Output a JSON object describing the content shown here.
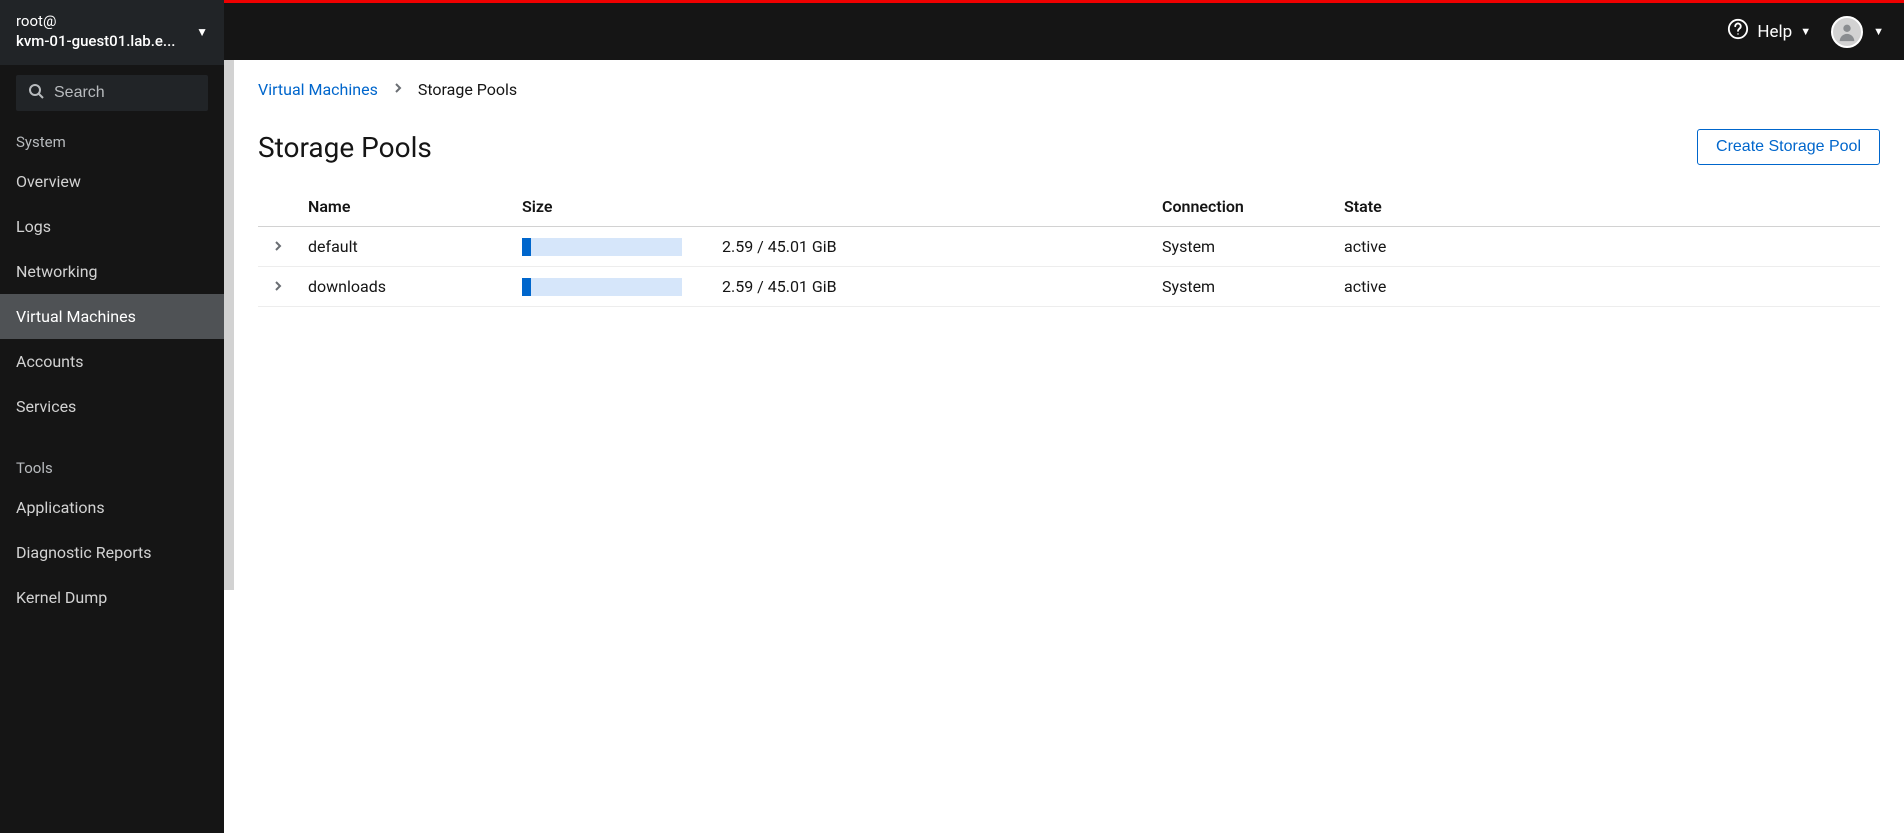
{
  "host_switcher": {
    "user_line": "root@",
    "host_line": "kvm-01-guest01.lab.e..."
  },
  "search": {
    "placeholder": "Search"
  },
  "sidebar": {
    "system_label": "System",
    "system_items": [
      {
        "label": "Overview",
        "active": false
      },
      {
        "label": "Logs",
        "active": false
      },
      {
        "label": "Networking",
        "active": false
      },
      {
        "label": "Virtual Machines",
        "active": true
      },
      {
        "label": "Accounts",
        "active": false
      },
      {
        "label": "Services",
        "active": false
      }
    ],
    "tools_label": "Tools",
    "tools_items": [
      {
        "label": "Applications"
      },
      {
        "label": "Diagnostic Reports"
      },
      {
        "label": "Kernel Dump"
      }
    ]
  },
  "topbar": {
    "help_label": "Help"
  },
  "breadcrumb": {
    "parent": "Virtual Machines",
    "current": "Storage Pools"
  },
  "page": {
    "title": "Storage Pools",
    "create_button": "Create Storage Pool"
  },
  "table": {
    "headers": {
      "name": "Name",
      "size": "Size",
      "connection": "Connection",
      "state": "State"
    },
    "rows": [
      {
        "name": "default",
        "used": 2.59,
        "total": 45.01,
        "size_text": "2.59 / 45.01 GiB",
        "pct": 5.75,
        "connection": "System",
        "state": "active"
      },
      {
        "name": "downloads",
        "used": 2.59,
        "total": 45.01,
        "size_text": "2.59 / 45.01 GiB",
        "pct": 5.75,
        "connection": "System",
        "state": "active"
      }
    ]
  }
}
